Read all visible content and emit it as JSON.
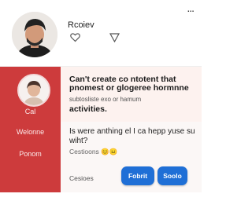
{
  "profile": {
    "name": "Rcoiev",
    "menu_glyph": "..."
  },
  "sidebar": {
    "items": [
      {
        "label": "Cal"
      },
      {
        "label": "Welonne"
      },
      {
        "label": "Ponom"
      }
    ]
  },
  "message": {
    "title_line_1": "Can't create co ntotent that",
    "title_line_2": "pnomest or glogeree hormnne",
    "subtitle": "subtosliste exo    or   hamum",
    "title_line_3": "activities.",
    "question": "Is were anthing el I ca hepp yuse su wiht?",
    "meta": "Cestioons 😊😐"
  },
  "footer": {
    "label": "Cesioes",
    "primary_button": "Fobrit",
    "secondary_button": "Soolo"
  },
  "colors": {
    "sidebar": "#cd3b3c",
    "button": "#1f6fd6"
  },
  "icons": [
    "heart-icon",
    "share-icon",
    "more-icon"
  ]
}
